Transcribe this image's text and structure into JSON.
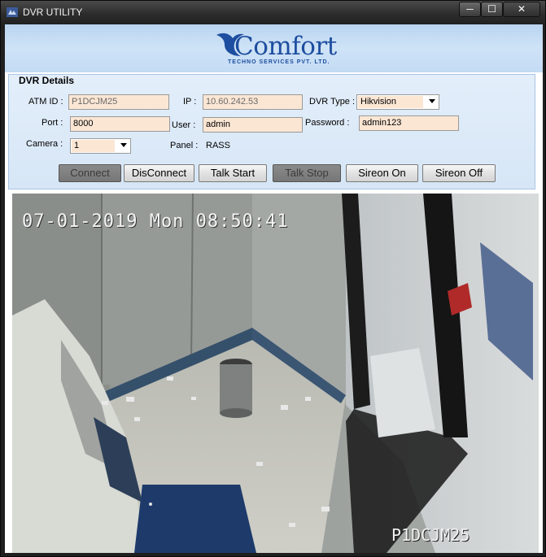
{
  "window": {
    "title": "DVR UTILITY",
    "controls": [
      "─",
      "☐",
      "✕"
    ]
  },
  "brand": {
    "name": "Comfort",
    "tagline": "TECHNO SERVICES PVT. LTD.",
    "color": "#1e4ea0"
  },
  "dvr": {
    "group_title": "DVR Details",
    "atm_id": {
      "label": "ATM ID :",
      "value": "P1DCJM25"
    },
    "ip": {
      "label": "IP :",
      "value": "10.60.242.53"
    },
    "dvr_type": {
      "label": "DVR Type :",
      "value": "Hikvision"
    },
    "port": {
      "label": "Port :",
      "value": "8000"
    },
    "user": {
      "label": "User :",
      "value": "admin"
    },
    "password": {
      "label": "Password :",
      "value": "admin123"
    },
    "camera": {
      "label": "Camera :",
      "value": "1"
    },
    "panel": {
      "label": "Panel :",
      "value": "RASS"
    }
  },
  "buttons": {
    "connect": "Connect",
    "disconnect": "DisConnect",
    "talk_start": "Talk Start",
    "talk_stop": "Talk Stop",
    "siren_on": "Sireon On",
    "siren_off": "Sireon Off"
  },
  "video": {
    "timestamp": "07-01-2019 Mon 08:50:41",
    "camera_name": "P1DCJM25"
  }
}
